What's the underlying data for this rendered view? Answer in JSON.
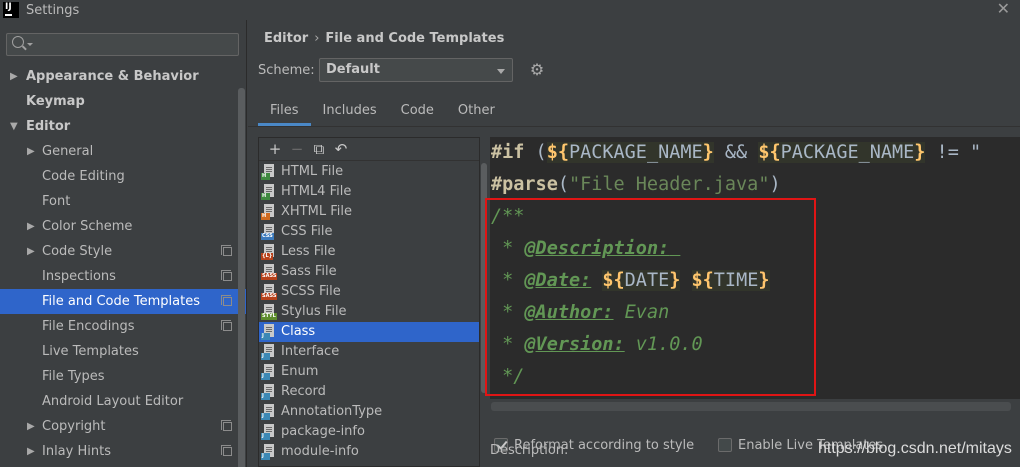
{
  "window": {
    "title": "Settings",
    "app_icon": "IJ"
  },
  "search": {
    "placeholder": ""
  },
  "sidebar": {
    "items": [
      {
        "label": "Appearance & Behavior",
        "arrow": "▶"
      },
      {
        "label": "Keymap"
      },
      {
        "label": "Editor",
        "arrow": "▼"
      },
      {
        "label": "General",
        "arrow": "▶"
      },
      {
        "label": "Code Editing"
      },
      {
        "label": "Font"
      },
      {
        "label": "Color Scheme",
        "arrow": "▶"
      },
      {
        "label": "Code Style",
        "arrow": "▶"
      },
      {
        "label": "Inspections"
      },
      {
        "label": "File and Code Templates"
      },
      {
        "label": "File Encodings"
      },
      {
        "label": "Live Templates"
      },
      {
        "label": "File Types"
      },
      {
        "label": "Android Layout Editor"
      },
      {
        "label": "Copyright",
        "arrow": "▶"
      },
      {
        "label": "Inlay Hints",
        "arrow": "▶"
      }
    ]
  },
  "breadcrumb": {
    "parent": "Editor",
    "separator": "›",
    "current": "File and Code Templates"
  },
  "scheme": {
    "label": "Scheme:",
    "value": "Default"
  },
  "tabs": [
    "Files",
    "Includes",
    "Code",
    "Other"
  ],
  "toolbar": {
    "add": "+",
    "remove": "−",
    "copy": "⧉",
    "reset": "↶"
  },
  "files": [
    {
      "name": "HTML File",
      "tag": "H",
      "tag_color": "#3f8a3f"
    },
    {
      "name": "HTML4 File",
      "tag": "H",
      "tag_color": "#3f8a3f"
    },
    {
      "name": "XHTML File",
      "tag": "H",
      "tag_color": "#d26a1f"
    },
    {
      "name": "CSS File",
      "tag": "CSS",
      "tag_color": "#3c7bbd"
    },
    {
      "name": "Less File",
      "tag": "{L}",
      "tag_color": "#b8421b"
    },
    {
      "name": "Sass File",
      "tag": "SASS",
      "tag_color": "#b8421b"
    },
    {
      "name": "SCSS File",
      "tag": "SASS",
      "tag_color": "#b8421b"
    },
    {
      "name": "Stylus File",
      "tag": "STYL",
      "tag_color": "#5d8d2d"
    },
    {
      "name": "Class",
      "tag": "J",
      "tag_color": "#3c88b5"
    },
    {
      "name": "Interface",
      "tag": "J",
      "tag_color": "#3c88b5"
    },
    {
      "name": "Enum",
      "tag": "J",
      "tag_color": "#3c88b5"
    },
    {
      "name": "Record",
      "tag": "J",
      "tag_color": "#3c88b5"
    },
    {
      "name": "AnnotationType",
      "tag": "J",
      "tag_color": "#3c88b5"
    },
    {
      "name": "package-info",
      "tag": "J",
      "tag_color": "#3c88b5"
    },
    {
      "name": "module-info",
      "tag": "J",
      "tag_color": "#3c88b5"
    }
  ],
  "editor": {
    "line1": {
      "kw": "#if",
      "open": " (",
      "v1a": "${",
      "v1b": "PACKAGE_NAME",
      "v1c": "}",
      "and": " && ",
      "v2a": "${",
      "v2b": "PACKAGE_NAME",
      "v2c": "}",
      "neq": " != \""
    },
    "line2": {
      "kw": "#parse",
      "open": "(",
      "str": "\"File Header.java\"",
      "close": ")"
    },
    "line3": "/**",
    "line4": {
      "star": " * ",
      "tag": "@Description:",
      "rest": " "
    },
    "line5": {
      "star": " * ",
      "tag": "@Date:",
      "sp": " ",
      "d1a": "${",
      "d1b": "DATE",
      "d1c": "}",
      "sp2": " ",
      "d2a": "${",
      "d2b": "TIME",
      "d2c": "}"
    },
    "line6": {
      "star": " * ",
      "tag": "@Author:",
      "rest": " Evan"
    },
    "line7": {
      "star": " * ",
      "tag": "@Version:",
      "rest": " v1.0.0"
    },
    "line8": " */"
  },
  "options": {
    "reformat": "Reformat according to style",
    "live_templates": "Enable Live Templates"
  },
  "description_label": "Description:",
  "watermark": "https://blog.csdn.net/mitays"
}
